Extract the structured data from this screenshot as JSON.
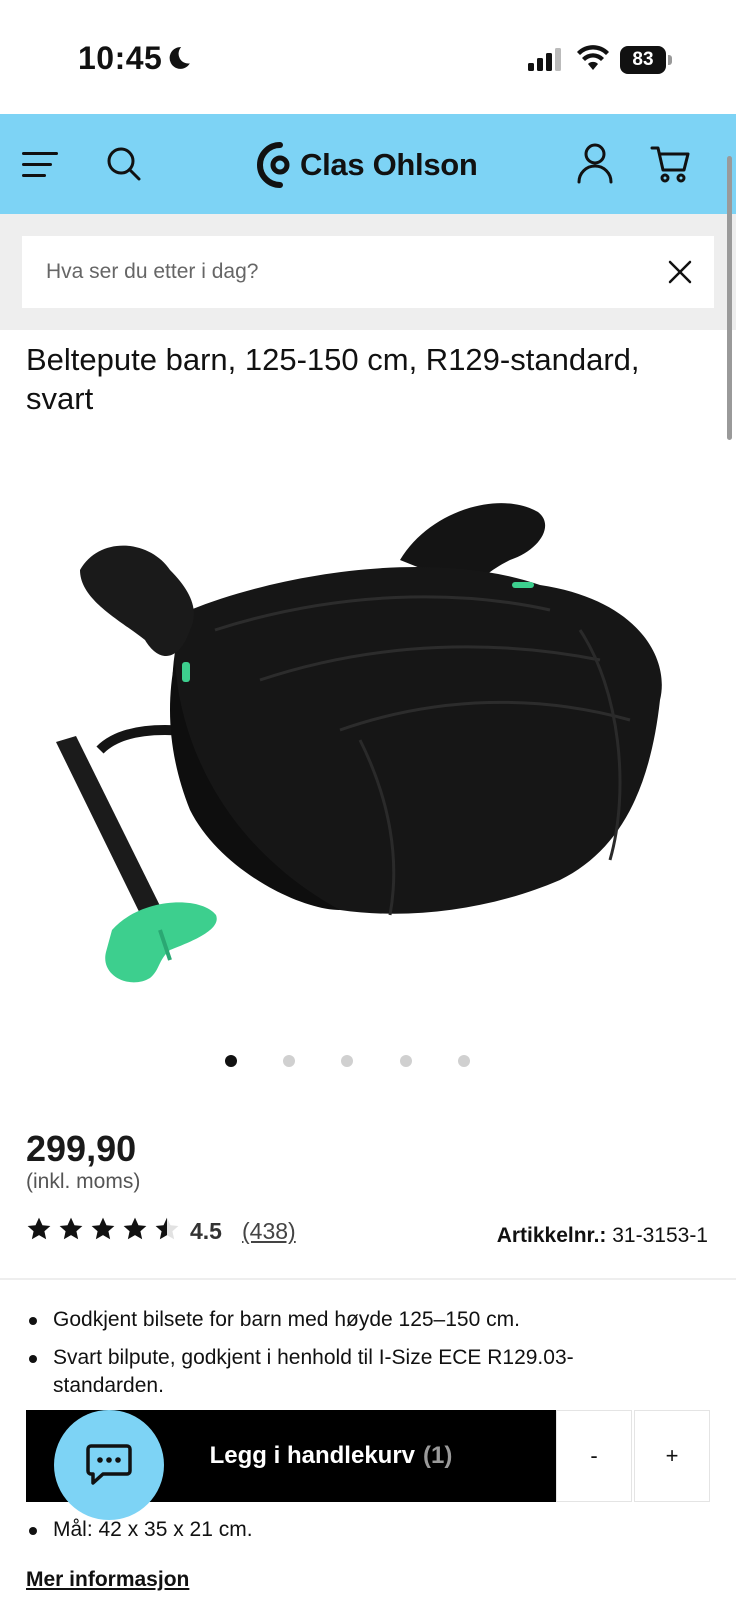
{
  "status_bar": {
    "time": "10:45",
    "battery": "83"
  },
  "header": {
    "brand": "Clas Ohlson",
    "icons": [
      "menu-icon",
      "search-icon",
      "account-icon",
      "cart-icon"
    ]
  },
  "search": {
    "placeholder": "Hva ser du etter i dag?"
  },
  "product": {
    "title": "Beltepute barn, 125-150 cm, R129-standard, svart",
    "gallery_total": 5,
    "gallery_active": 1,
    "price": "299,90",
    "vat_note": "(inkl. moms)",
    "rating_value": "4.5",
    "rating_count": "(438)",
    "article_label": "Artikkelnr.:",
    "article_number": "31-3153-1",
    "bullets": [
      "Godkjent bilsete for barn med høyde 125–150 cm.",
      "Svart bilpute, godkjent i henhold til I-Size ECE R129.03-standarden."
    ],
    "bullet_last": "Mål: 42 x 35 x 21 cm.",
    "more_info": "Mer informasjon"
  },
  "cart": {
    "add_label": "Legg i handlekurv",
    "quantity": "(1)",
    "minus": "-",
    "plus": "+"
  },
  "colors": {
    "accent": "#7dd3f5",
    "button": "#000000",
    "seat_clip": "#3dcf8e"
  }
}
